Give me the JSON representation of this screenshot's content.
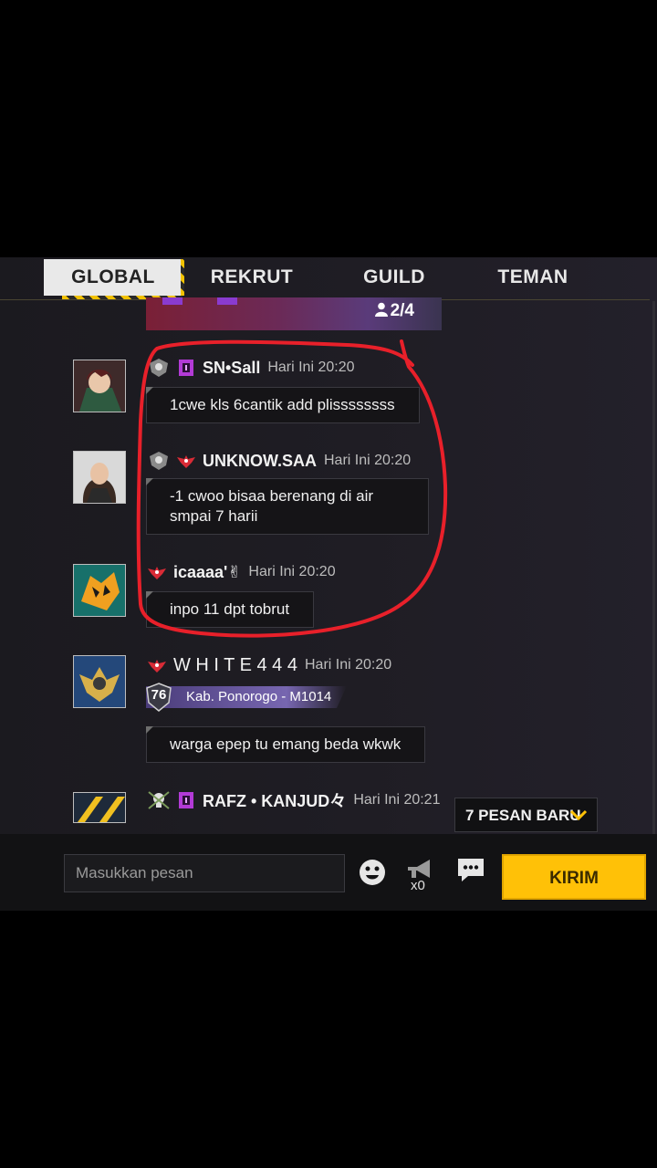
{
  "tabs": [
    {
      "label": "GLOBAL",
      "active": true
    },
    {
      "label": "REKRUT",
      "active": false
    },
    {
      "label": "GUILD",
      "active": false
    },
    {
      "label": "TEMAN",
      "active": false
    }
  ],
  "banner": {
    "count": "2/4"
  },
  "messages": [
    {
      "name": "SN•Sall",
      "time": "Hari Ini 20:20",
      "text": "1cwe kls 6cantik add plissssssss"
    },
    {
      "name": "UNKNOW.SAA",
      "time": "Hari Ini 20:20",
      "text": "-1 cwoo bisaa berenang di air smpai 7 harii"
    },
    {
      "name": "icaaaa'✌",
      "time": "Hari Ini 20:20",
      "text": "inpo 11 dpt tobrut"
    },
    {
      "name": "W H I T E 4 4 4",
      "time": "Hari Ini 20:20",
      "region": "Kab. Ponorogo - M1014",
      "level": "76",
      "text": "warga epep tu emang beda wkwk"
    },
    {
      "name": "RAFZ • KANJUD々",
      "time": "Hari Ini 20:21"
    }
  ],
  "new_messages": "7 PESAN BARU",
  "composer": {
    "placeholder": "Masukkan pesan",
    "megaphone_count": "x0",
    "send_label": "KIRIM"
  },
  "colors": {
    "accent": "#ffc107",
    "annotation": "#e8202a",
    "bubble_bg": "#151417"
  },
  "icons": [
    "emoji-icon",
    "megaphone-icon",
    "quick-chat-icon",
    "chevron-down-icon",
    "user-icon"
  ]
}
